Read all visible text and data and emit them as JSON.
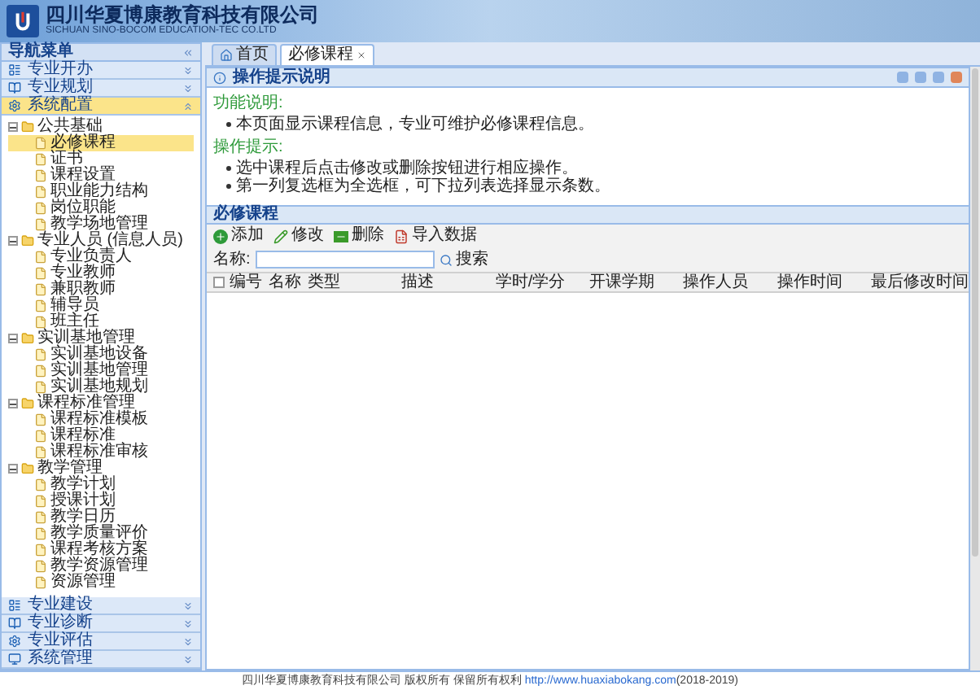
{
  "header": {
    "company": "四川华夏博康教育科技有限公司",
    "company_en": "SICHUAN SINO-BOCOM EDUCATION-TEC CO.LTD"
  },
  "sidebar": {
    "title": "导航菜单",
    "top_sections": [
      {
        "label": "专业开办",
        "expanded": false
      },
      {
        "label": "专业规划",
        "expanded": false
      },
      {
        "label": "系统配置",
        "expanded": true
      }
    ],
    "tree": [
      {
        "label": "公共基础",
        "expanded": true,
        "selected": false,
        "children": [
          {
            "label": "必修课程",
            "selected": true
          },
          {
            "label": "证书",
            "selected": false
          },
          {
            "label": "课程设置",
            "selected": false
          },
          {
            "label": "职业能力结构",
            "selected": false
          },
          {
            "label": "岗位职能",
            "selected": false
          },
          {
            "label": "教学场地管理",
            "selected": false
          }
        ]
      },
      {
        "label": "专业人员 (信息人员)",
        "expanded": true,
        "selected": false,
        "children": [
          {
            "label": "专业负责人",
            "selected": false
          },
          {
            "label": "专业教师",
            "selected": false
          },
          {
            "label": "兼职教师",
            "selected": false
          },
          {
            "label": "辅导员",
            "selected": false
          },
          {
            "label": "班主任",
            "selected": false
          }
        ]
      },
      {
        "label": "实训基地管理",
        "expanded": true,
        "selected": false,
        "children": [
          {
            "label": "实训基地设备",
            "selected": false
          },
          {
            "label": "实训基地管理",
            "selected": false
          },
          {
            "label": "实训基地规划",
            "selected": false
          }
        ]
      },
      {
        "label": "课程标准管理",
        "expanded": true,
        "selected": false,
        "children": [
          {
            "label": "课程标准模板",
            "selected": false
          },
          {
            "label": "课程标准",
            "selected": false
          },
          {
            "label": "课程标准审核",
            "selected": false
          }
        ]
      },
      {
        "label": "教学管理",
        "expanded": true,
        "selected": false,
        "children": [
          {
            "label": "教学计划",
            "selected": false
          },
          {
            "label": "授课计划",
            "selected": false
          },
          {
            "label": "教学日历",
            "selected": false
          },
          {
            "label": "教学质量评价",
            "selected": false
          },
          {
            "label": "课程考核方案",
            "selected": false
          },
          {
            "label": "教学资源管理",
            "selected": false
          },
          {
            "label": "资源管理",
            "selected": false
          }
        ]
      }
    ],
    "bottom_sections": [
      {
        "label": "专业建设",
        "expanded": false
      },
      {
        "label": "专业诊断",
        "expanded": false
      },
      {
        "label": "专业评估",
        "expanded": false
      },
      {
        "label": "系统管理",
        "expanded": false
      }
    ]
  },
  "tabs": [
    {
      "label": "首页",
      "selected": false,
      "closable": false
    },
    {
      "label": "必修课程",
      "selected": true,
      "closable": true
    }
  ],
  "info_panel": {
    "title": "操作提示说明",
    "sections": [
      {
        "heading": "功能说明:",
        "bullets": [
          "本页面显示课程信息，专业可维护必修课程信息。"
        ]
      },
      {
        "heading": "操作提示:",
        "bullets": [
          "选中课程后点击修改或删除按钮进行相应操作。",
          "第一列复选框为全选框，可下拉列表选择显示条数。"
        ]
      }
    ]
  },
  "grid": {
    "title": "必修课程",
    "toolbar": [
      {
        "label": "添加",
        "kind": "add"
      },
      {
        "label": "修改",
        "kind": "edit"
      },
      {
        "label": "删除",
        "kind": "delete"
      },
      {
        "label": "导入数据",
        "kind": "import"
      }
    ],
    "search": {
      "label": "名称:",
      "button": "搜索"
    },
    "select_all_checked": false,
    "columns": [
      "编号",
      "名称",
      "类型",
      "描述",
      "学时/学分",
      "开课学期",
      "操作人员",
      "操作时间",
      "最后修改时间"
    ]
  },
  "footer": {
    "text": "四川华夏博康教育科技有限公司 版权所有 保留所有权利 ",
    "link": "http://www.huaxiabokang.com",
    "suffix": "(2018-2019)"
  }
}
